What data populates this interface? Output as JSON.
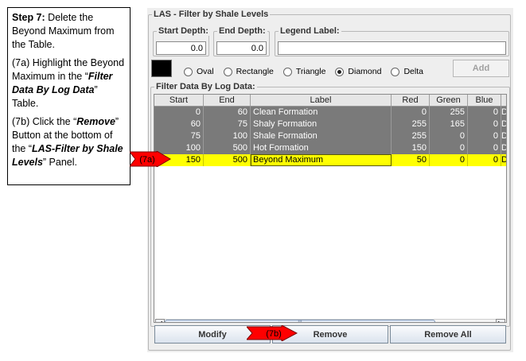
{
  "instructions": {
    "step_bold": "Step 7:",
    "step_text": " Delete the Beyond Maximum from the Table.",
    "a_pre": "(7a) Highlight the Beyond Maximum  in the “",
    "a_bold": "Filter Data By Log Data",
    "a_post": "” Table.",
    "b_pre": "(7b) Click the “",
    "b_bold": "Remove",
    "b_mid": "” Button at the bottom of the “",
    "b_bold2": "LAS-Filter by Shale Levels",
    "b_post": "” Panel."
  },
  "panel": {
    "title": "LAS - Filter by Shale Levels",
    "start_depth": {
      "label": "Start Depth:",
      "value": "0.0"
    },
    "end_depth": {
      "label": "End Depth:",
      "value": "0.0"
    },
    "legend_label": {
      "label": "Legend Label:",
      "value": ""
    },
    "swatch_color": "#000000",
    "shapes": [
      {
        "label": "Oval",
        "selected": false
      },
      {
        "label": "Rectangle",
        "selected": false
      },
      {
        "label": "Triangle",
        "selected": false
      },
      {
        "label": "Diamond",
        "selected": true
      },
      {
        "label": "Delta",
        "selected": false
      }
    ],
    "add_label": "Add",
    "table_title": "Filter Data By Log Data:",
    "columns": [
      "Start",
      "End",
      "Label",
      "Red",
      "Green",
      "Blue"
    ],
    "rows": [
      {
        "start": "0",
        "end": "60",
        "label": "Clean Formation",
        "red": "0",
        "green": "255",
        "blue": "0",
        "extra": "D"
      },
      {
        "start": "60",
        "end": "75",
        "label": "Shaly Formation",
        "red": "255",
        "green": "165",
        "blue": "0",
        "extra": "D"
      },
      {
        "start": "75",
        "end": "100",
        "label": "Shale Formation",
        "red": "255",
        "green": "0",
        "blue": "0",
        "extra": "D"
      },
      {
        "start": "100",
        "end": "500",
        "label": "Hot Formation",
        "red": "150",
        "green": "0",
        "blue": "0",
        "extra": "D"
      },
      {
        "start": "150",
        "end": "500",
        "label": "Beyond Maximum",
        "red": "50",
        "green": "0",
        "blue": "0",
        "extra": "D"
      }
    ],
    "scroll_grip": "|||",
    "modify_label": "Modify",
    "remove_label": "Remove",
    "remove_all_label": "Remove All"
  },
  "callouts": {
    "a": "(7a)",
    "b": "(7b)",
    "color": "#ff0000"
  }
}
